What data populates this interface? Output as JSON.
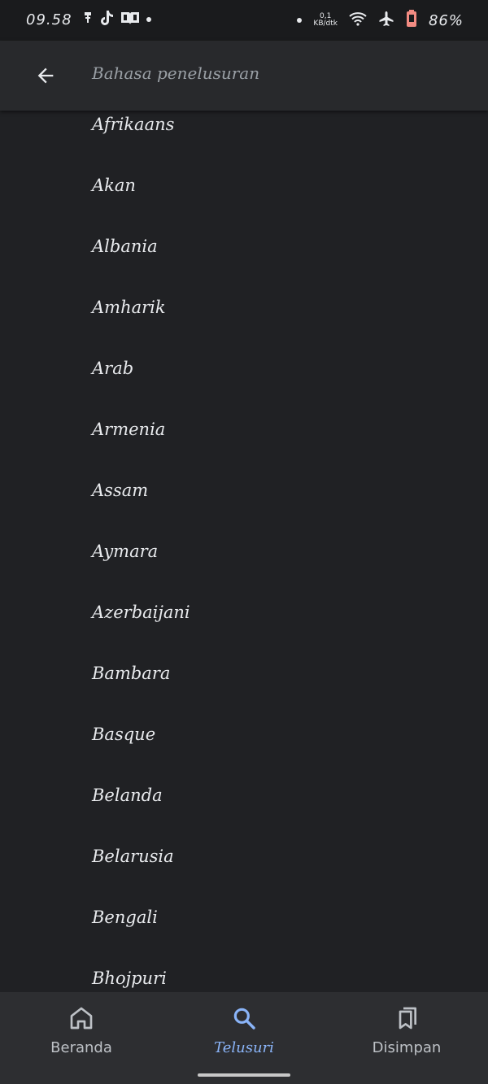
{
  "status_bar": {
    "time": "09.58",
    "net_speed_value": "0,1",
    "net_speed_unit": "KB/dtk",
    "battery_percent": "86%"
  },
  "app_bar": {
    "title": "Bahasa penelusuran"
  },
  "languages": [
    "Afrikaans",
    "Akan",
    "Albania",
    "Amharik",
    "Arab",
    "Armenia",
    "Assam",
    "Aymara",
    "Azerbaijani",
    "Bambara",
    "Basque",
    "Belanda",
    "Belarusia",
    "Bengali",
    "Bhojpuri"
  ],
  "bottom_nav": {
    "items": [
      {
        "label": "Beranda",
        "icon": "home-icon",
        "active": false
      },
      {
        "label": "Telusuri",
        "icon": "search-icon",
        "active": true
      },
      {
        "label": "Disimpan",
        "icon": "bookmarks-icon",
        "active": false
      }
    ]
  },
  "colors": {
    "background": "#202124",
    "app_bar": "#28292c",
    "text": "#e8eaed",
    "muted": "#9aa0a6",
    "accent": "#8ab4f8",
    "battery": "#f28b82"
  }
}
